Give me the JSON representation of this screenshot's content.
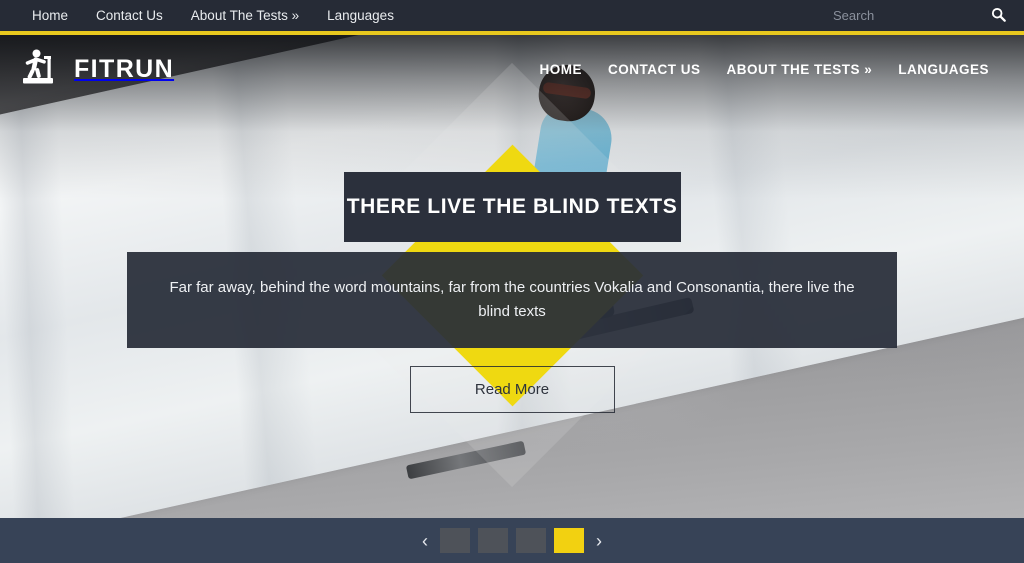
{
  "topbar": {
    "nav": [
      {
        "label": "Home"
      },
      {
        "label": "Contact Us"
      },
      {
        "label": "About The Tests »"
      },
      {
        "label": "Languages"
      }
    ],
    "search": {
      "placeholder": "Search",
      "value": "",
      "icon": "search-icon"
    },
    "background_color": "#262b36",
    "accent_rule_color": "#e8c81e"
  },
  "header": {
    "logo": {
      "icon": "treadmill-runner-icon",
      "text": "FITRUN"
    },
    "nav": [
      {
        "label": "HOME"
      },
      {
        "label": "CONTACT US"
      },
      {
        "label": "ABOUT THE TESTS »"
      },
      {
        "label": "LANGUAGES"
      }
    ]
  },
  "hero": {
    "title": "THERE LIVE THE BLIND TEXTS",
    "subtitle": "Far far away, behind the word mountains, far from the countries Vokalia and Consonantia, there live the blind texts",
    "button_label": "Read More",
    "panel_color": "#2b303c",
    "diamond_color": "#efd911",
    "image_alt": "skier-on-snowy-mountain-photo"
  },
  "carousel": {
    "prev_label": "‹",
    "next_label": "›",
    "prev_icon": "chevron-left-icon",
    "next_icon": "chevron-right-icon",
    "active_index": 3,
    "active_color": "#f2d111",
    "inactive_color": "#4e5259",
    "background_color": "#374357",
    "slides": [
      {
        "label": ""
      },
      {
        "label": ""
      },
      {
        "label": ""
      },
      {
        "label": ""
      }
    ]
  }
}
